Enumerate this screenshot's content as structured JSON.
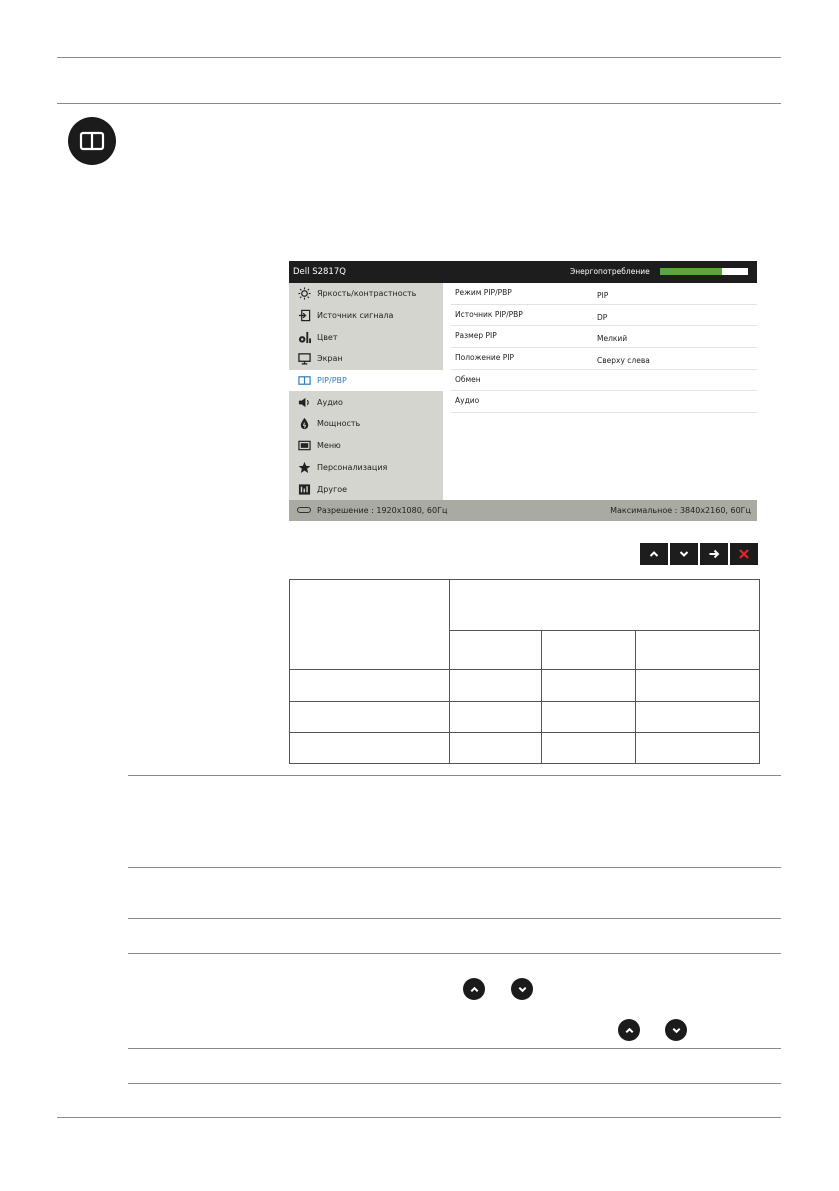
{
  "osd": {
    "model": "Dell S2817Q",
    "energy_label": "Энергопотребление",
    "energy_level_percent": 70,
    "menu": [
      {
        "label": "Яркость/контрастность",
        "icon": "brightness-icon"
      },
      {
        "label": "Источник сигнала",
        "icon": "input-source-icon"
      },
      {
        "label": "Цвет",
        "icon": "color-icon"
      },
      {
        "label": "Экран",
        "icon": "display-icon"
      },
      {
        "label": "PIP/PBP",
        "icon": "pip-pbp-icon",
        "active": true
      },
      {
        "label": "Аудио",
        "icon": "speaker-icon"
      },
      {
        "label": "Мощность",
        "icon": "power-icon"
      },
      {
        "label": "Меню",
        "icon": "menu-icon"
      },
      {
        "label": "Персонализация",
        "icon": "star-icon"
      },
      {
        "label": "Другое",
        "icon": "other-icon"
      }
    ],
    "submenu": [
      {
        "label": "Режим PIP/PBP",
        "value": "PIP"
      },
      {
        "label": "Источник PIP/PBP",
        "value": "DP"
      },
      {
        "label": "Размер PIP",
        "value": "Мелкий"
      },
      {
        "label": "Положение PIP",
        "value": "Сверху слева"
      },
      {
        "label": "Обмен",
        "value": ""
      },
      {
        "label": "Аудио",
        "value": ""
      }
    ],
    "footer_left": "Разрешение : 1920x1080, 60Гц",
    "footer_right": "Максимальное : 3840x2160, 60Гц"
  },
  "icons": {
    "section": "pip-pbp-icon",
    "nav": [
      "chevron-up-icon",
      "chevron-down-icon",
      "arrow-right-icon",
      "close-icon"
    ],
    "inline": [
      "chevron-up-icon",
      "chevron-down-icon"
    ]
  },
  "colors": {
    "osd_header": "#1d1d1d",
    "osd_menu": "#d4d5cf",
    "osd_footer": "#a9aaa2",
    "active_text": "#2f7fc1",
    "energy_fill": "#58a63c",
    "close_red": "#e0262b"
  }
}
